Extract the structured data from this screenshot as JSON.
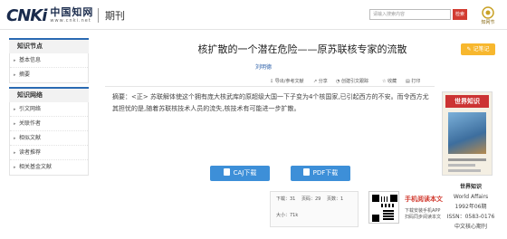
{
  "header": {
    "logo_text": "CNKi",
    "logo_cn": "中国知网",
    "logo_en": "www.cnki.net",
    "section": "期刊",
    "search_placeholder": "请输入搜索内容",
    "search_button": "检索",
    "brand_right": "知网节"
  },
  "sidebar": {
    "group1_title": "知识节点",
    "group1_items": [
      {
        "label": "基本信息"
      },
      {
        "label": "摘要"
      }
    ],
    "group2_title": "知识网络",
    "group2_items": [
      {
        "label": "引文网络"
      },
      {
        "label": "关联作者"
      },
      {
        "label": "相似文献"
      },
      {
        "label": "读者推荐"
      },
      {
        "label": "相关基金文献"
      }
    ]
  },
  "article": {
    "title": "核扩散的一个潜在危险——原苏联核专家的流散",
    "author": "刘明德",
    "tools": {
      "export": "导出/参考文献",
      "share": "分享",
      "citation": "创建引文跟踪",
      "favorite": "收藏",
      "print": "打印"
    },
    "abstract": "摘要：<正> 苏联解体使这个拥有庞大核武库的原超级大国一下子变为4个核国家,已引起西方的不安。而令西方尤其担忧的是,随着苏联核技术人员的流失,核技术有可能进一步扩散。",
    "download_caj": "CAJ下载",
    "download_pdf": "PDF下载",
    "stats": {
      "downloads": "下载：31",
      "pages": "页码：29",
      "page_count": "页数：1",
      "size": "大小：71k"
    },
    "qr": {
      "title": "手机阅读本文",
      "line1": "下载安装手机APP",
      "line2": "扫码同步阅读本文"
    }
  },
  "journal": {
    "save_button": "记笔记",
    "cover_title": "世界知识",
    "name": "世界知识",
    "en_name": "World Affairs",
    "issue": "1992年06期",
    "issn": "ISSN：0583-0176",
    "tag": "中文核心期刊"
  },
  "colors": {
    "accent_blue": "#3d8fd8",
    "search_red": "#d23c31",
    "save_orange": "#f7b72e"
  }
}
